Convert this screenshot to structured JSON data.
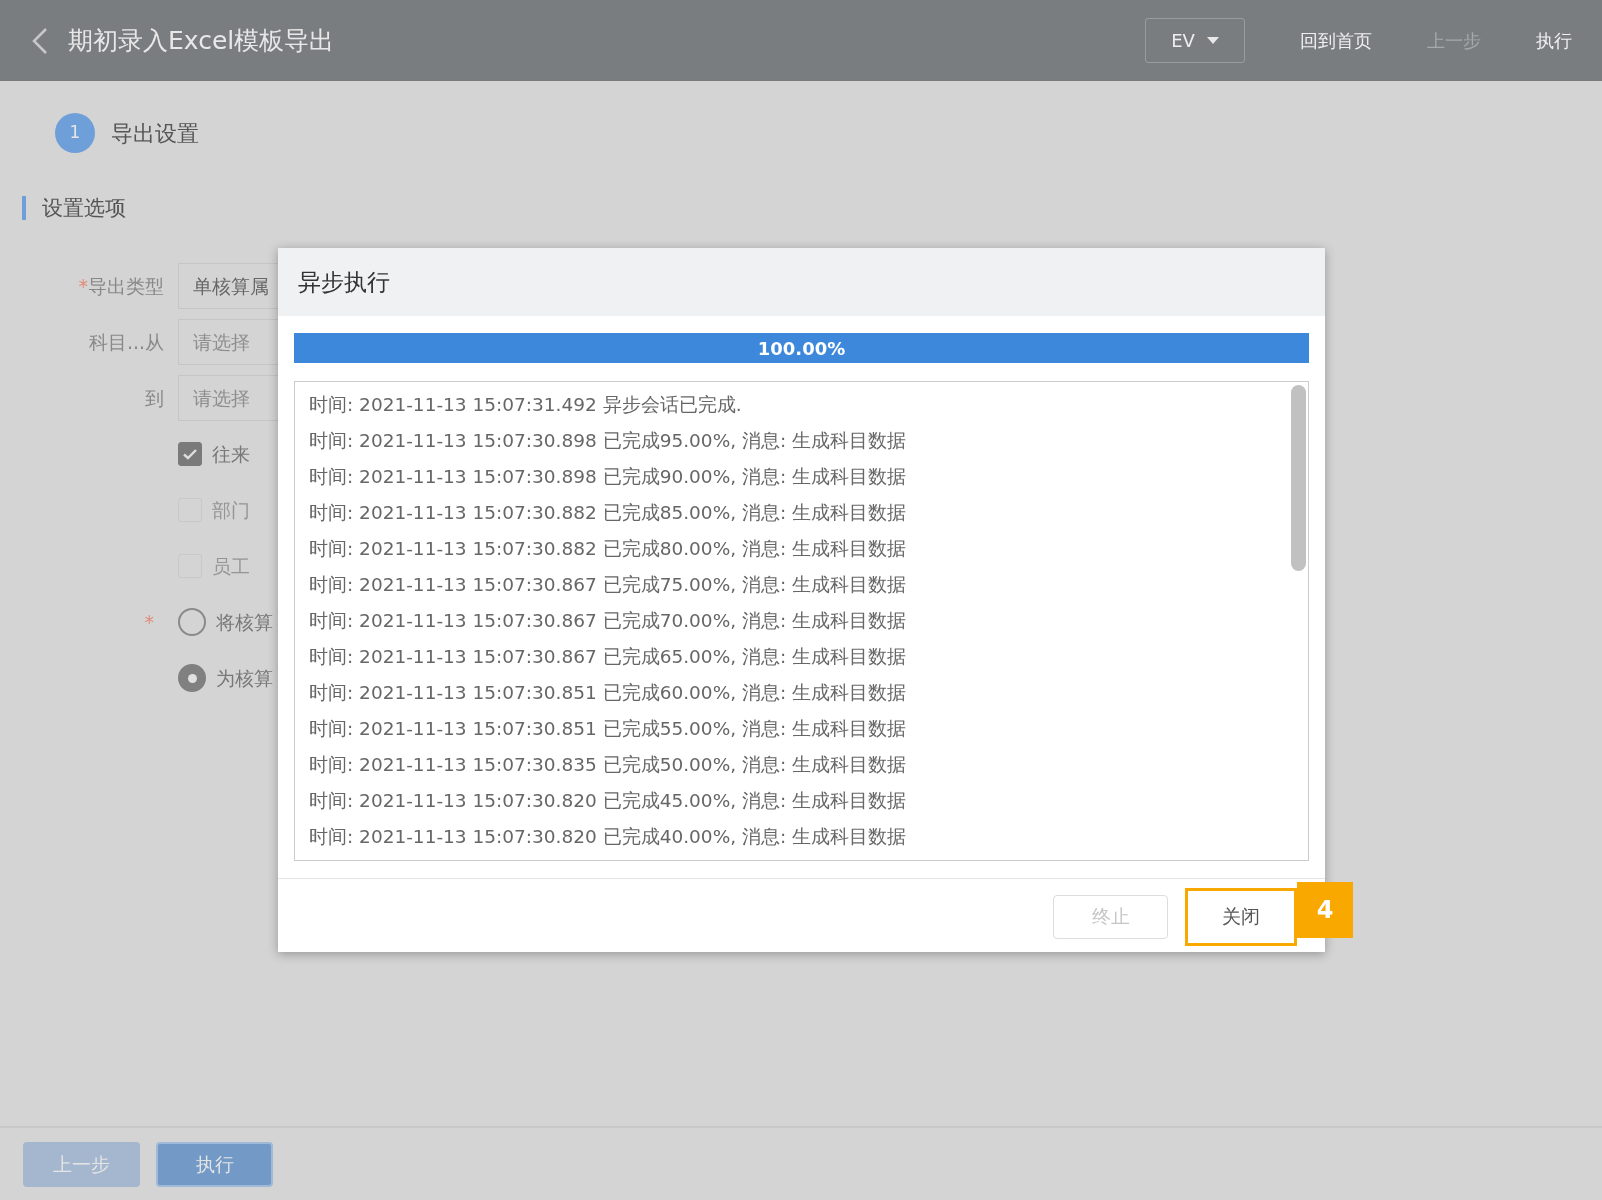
{
  "header": {
    "title": "期初录入Excel模板导出",
    "dropdown": "EV",
    "buttons": [
      {
        "label": "回到首页",
        "disabled": false
      },
      {
        "label": "上一步",
        "disabled": true
      },
      {
        "label": "执行",
        "disabled": false
      }
    ]
  },
  "steps": [
    {
      "number": "1",
      "label": "导出设置"
    }
  ],
  "section_title": "设置选项",
  "form": [
    {
      "kind": "select",
      "label": "导出类型",
      "required_mark": "*",
      "value": "单核算属"
    },
    {
      "kind": "select",
      "label": "科目...从",
      "placeholder": "请选择"
    },
    {
      "kind": "select",
      "label": "到",
      "placeholder": "请选择"
    },
    {
      "kind": "checkbox",
      "label": "往来",
      "checked": true,
      "disabled": false
    },
    {
      "kind": "checkbox",
      "label": "部门",
      "checked": false,
      "disabled": true
    },
    {
      "kind": "checkbox",
      "label": "员工",
      "checked": false,
      "disabled": true
    },
    {
      "kind": "radio",
      "label": "将核算",
      "selected": false,
      "required_mark": "*"
    },
    {
      "kind": "radio",
      "label": "为核算",
      "selected": true
    }
  ],
  "dialog": {
    "title": "异步执行",
    "progress": {
      "level": 1,
      "label": "100.00%"
    },
    "log": [
      "时间: 2021-11-13 15:07:31.492 异步会话已完成.",
      "时间: 2021-11-13 15:07:30.898 已完成95.00%, 消息: 生成科目数据",
      "时间: 2021-11-13 15:07:30.898 已完成90.00%, 消息: 生成科目数据",
      "时间: 2021-11-13 15:07:30.882 已完成85.00%, 消息: 生成科目数据",
      "时间: 2021-11-13 15:07:30.882 已完成80.00%, 消息: 生成科目数据",
      "时间: 2021-11-13 15:07:30.867 已完成75.00%, 消息: 生成科目数据",
      "时间: 2021-11-13 15:07:30.867 已完成70.00%, 消息: 生成科目数据",
      "时间: 2021-11-13 15:07:30.867 已完成65.00%, 消息: 生成科目数据",
      "时间: 2021-11-13 15:07:30.851 已完成60.00%, 消息: 生成科目数据",
      "时间: 2021-11-13 15:07:30.851 已完成55.00%, 消息: 生成科目数据",
      "时间: 2021-11-13 15:07:30.835 已完成50.00%, 消息: 生成科目数据",
      "时间: 2021-11-13 15:07:30.820 已完成45.00%, 消息: 生成科目数据",
      "时间: 2021-11-13 15:07:30.820 已完成40.00%, 消息: 生成科目数据"
    ],
    "buttons": [
      {
        "label": "终止",
        "disabled": true,
        "highlighted": false
      },
      {
        "label": "关闭",
        "disabled": false,
        "highlighted": true
      }
    ],
    "callout": "4"
  },
  "bottom_buttons": [
    {
      "label": "上一步",
      "disabled": true
    },
    {
      "label": "执行",
      "disabled": false
    }
  ]
}
